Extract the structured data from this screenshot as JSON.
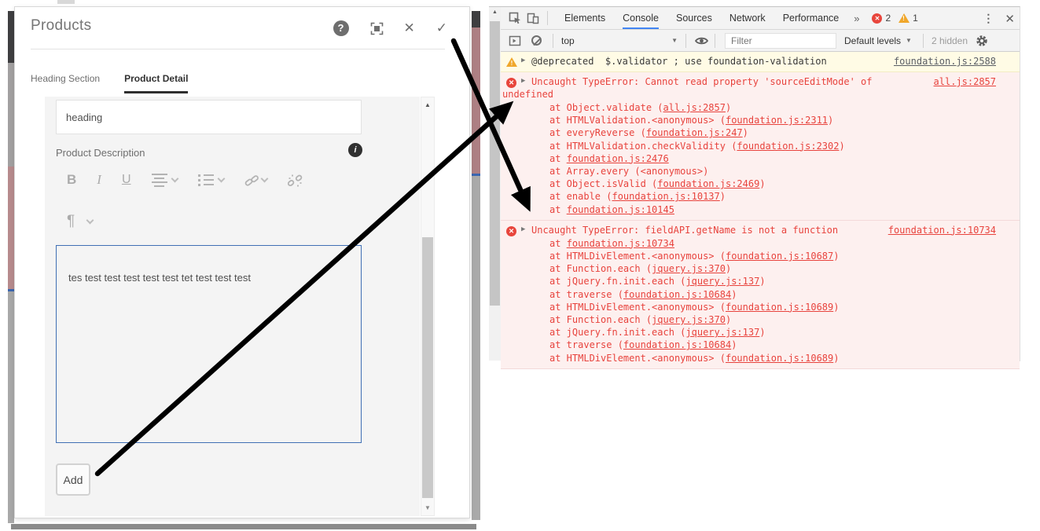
{
  "modal": {
    "title": "Products",
    "header_icons": {
      "help_glyph": "?",
      "close_glyph": "✕",
      "confirm_glyph": "✓"
    },
    "tabs": [
      {
        "label": "Heading Section",
        "active": false
      },
      {
        "label": "Product Detail",
        "active": true
      }
    ],
    "form": {
      "heading_value": "heading",
      "description_label": "Product Description",
      "info_glyph": "i",
      "rte_toolbar": {
        "bold": "B",
        "italic": "I",
        "underline": "U",
        "paragraph": "¶",
        "icons": [
          "bold",
          "italic",
          "underline",
          "align",
          "ordered-list",
          "link",
          "unlink",
          "paragraph-style"
        ]
      },
      "textarea_value": "tes test test test test test tet test test test",
      "add_label": "Add"
    }
  },
  "devtools": {
    "tabs": {
      "elements": "Elements",
      "console": "Console",
      "sources": "Sources",
      "network": "Network",
      "performance": "Performance",
      "overflow": "»"
    },
    "active_tab": "Console",
    "badges": {
      "errors": "2",
      "warnings": "1"
    },
    "window_controls": {
      "more_glyph": "⋮",
      "close_glyph": "✕"
    },
    "console_bar": {
      "context": "top",
      "filter_placeholder": "Filter",
      "levels_label": "Default levels",
      "hidden_label": "2 hidden"
    },
    "messages": [
      {
        "type": "warning",
        "text": "@deprecated  $.validator ; use foundation-validation",
        "link": "foundation.js:2588",
        "stack": []
      },
      {
        "type": "error",
        "text": "Uncaught TypeError: Cannot read property 'sourceEditMode' of undefined",
        "link": "all.js:2857",
        "stack": [
          {
            "before": "at Object.validate (",
            "link": "all.js:2857",
            "after": ")"
          },
          {
            "before": "at HTMLValidation.<anonymous> (",
            "link": "foundation.js:2311",
            "after": ")"
          },
          {
            "before": "at everyReverse (",
            "link": "foundation.js:247",
            "after": ")"
          },
          {
            "before": "at HTMLValidation.checkValidity (",
            "link": "foundation.js:2302",
            "after": ")"
          },
          {
            "before": "at ",
            "link": "foundation.js:2476",
            "after": ""
          },
          {
            "before": "at Array.every (<anonymous>)",
            "link": "",
            "after": ""
          },
          {
            "before": "at Object.isValid (",
            "link": "foundation.js:2469",
            "after": ")"
          },
          {
            "before": "at enable (",
            "link": "foundation.js:10137",
            "after": ")"
          },
          {
            "before": "at ",
            "link": "foundation.js:10145",
            "after": ""
          }
        ]
      },
      {
        "type": "error",
        "text": "Uncaught TypeError: fieldAPI.getName is not a function",
        "link": "foundation.js:10734",
        "stack": [
          {
            "before": "at ",
            "link": "foundation.js:10734",
            "after": ""
          },
          {
            "before": "at HTMLDivElement.<anonymous> (",
            "link": "foundation.js:10687",
            "after": ")"
          },
          {
            "before": "at Function.each (",
            "link": "jquery.js:370",
            "after": ")"
          },
          {
            "before": "at jQuery.fn.init.each (",
            "link": "jquery.js:137",
            "after": ")"
          },
          {
            "before": "at traverse (",
            "link": "foundation.js:10684",
            "after": ")"
          },
          {
            "before": "at HTMLDivElement.<anonymous> (",
            "link": "foundation.js:10689",
            "after": ")"
          },
          {
            "before": "at Function.each (",
            "link": "jquery.js:370",
            "after": ")"
          },
          {
            "before": "at jQuery.fn.init.each (",
            "link": "jquery.js:137",
            "after": ")"
          },
          {
            "before": "at traverse (",
            "link": "foundation.js:10684",
            "after": ")"
          },
          {
            "before": "at HTMLDivElement.<anonymous> (",
            "link": "foundation.js:10689",
            "after": ")"
          }
        ]
      }
    ]
  },
  "colors": {
    "accent_blue": "#4285f4",
    "error_text": "#e8433d",
    "error_bg": "#fdf0ef",
    "warning_bg": "#fffbe5",
    "error_icon": "#e8453c",
    "warning_icon": "#f0a72b",
    "textarea_border": "#4070b4",
    "annotation_arrow": "#000000"
  }
}
